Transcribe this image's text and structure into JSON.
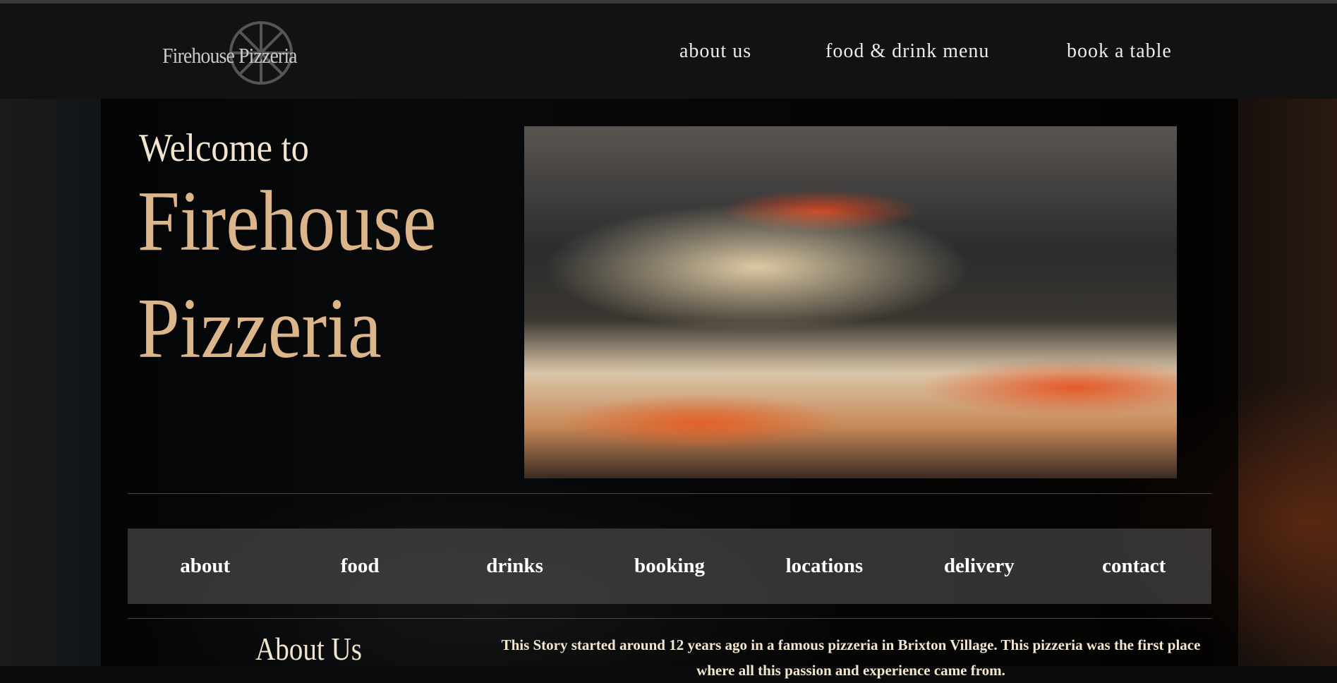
{
  "header": {
    "logo_text": "Firehouse Pizzeria",
    "nav": [
      "about us",
      "food & drink menu",
      "book a table"
    ]
  },
  "hero": {
    "welcome": "Welcome to",
    "title_line1": "Firehouse",
    "title_line2": "Pizzeria"
  },
  "subnav": [
    "about",
    "food",
    "drinks",
    "booking",
    "locations",
    "delivery",
    "contact"
  ],
  "about": {
    "heading": "About Us",
    "text": "This Story started around 12 years ago in a famous pizzeria in Brixton Village. This pizzeria was the first place where all this passion and experience came from."
  }
}
